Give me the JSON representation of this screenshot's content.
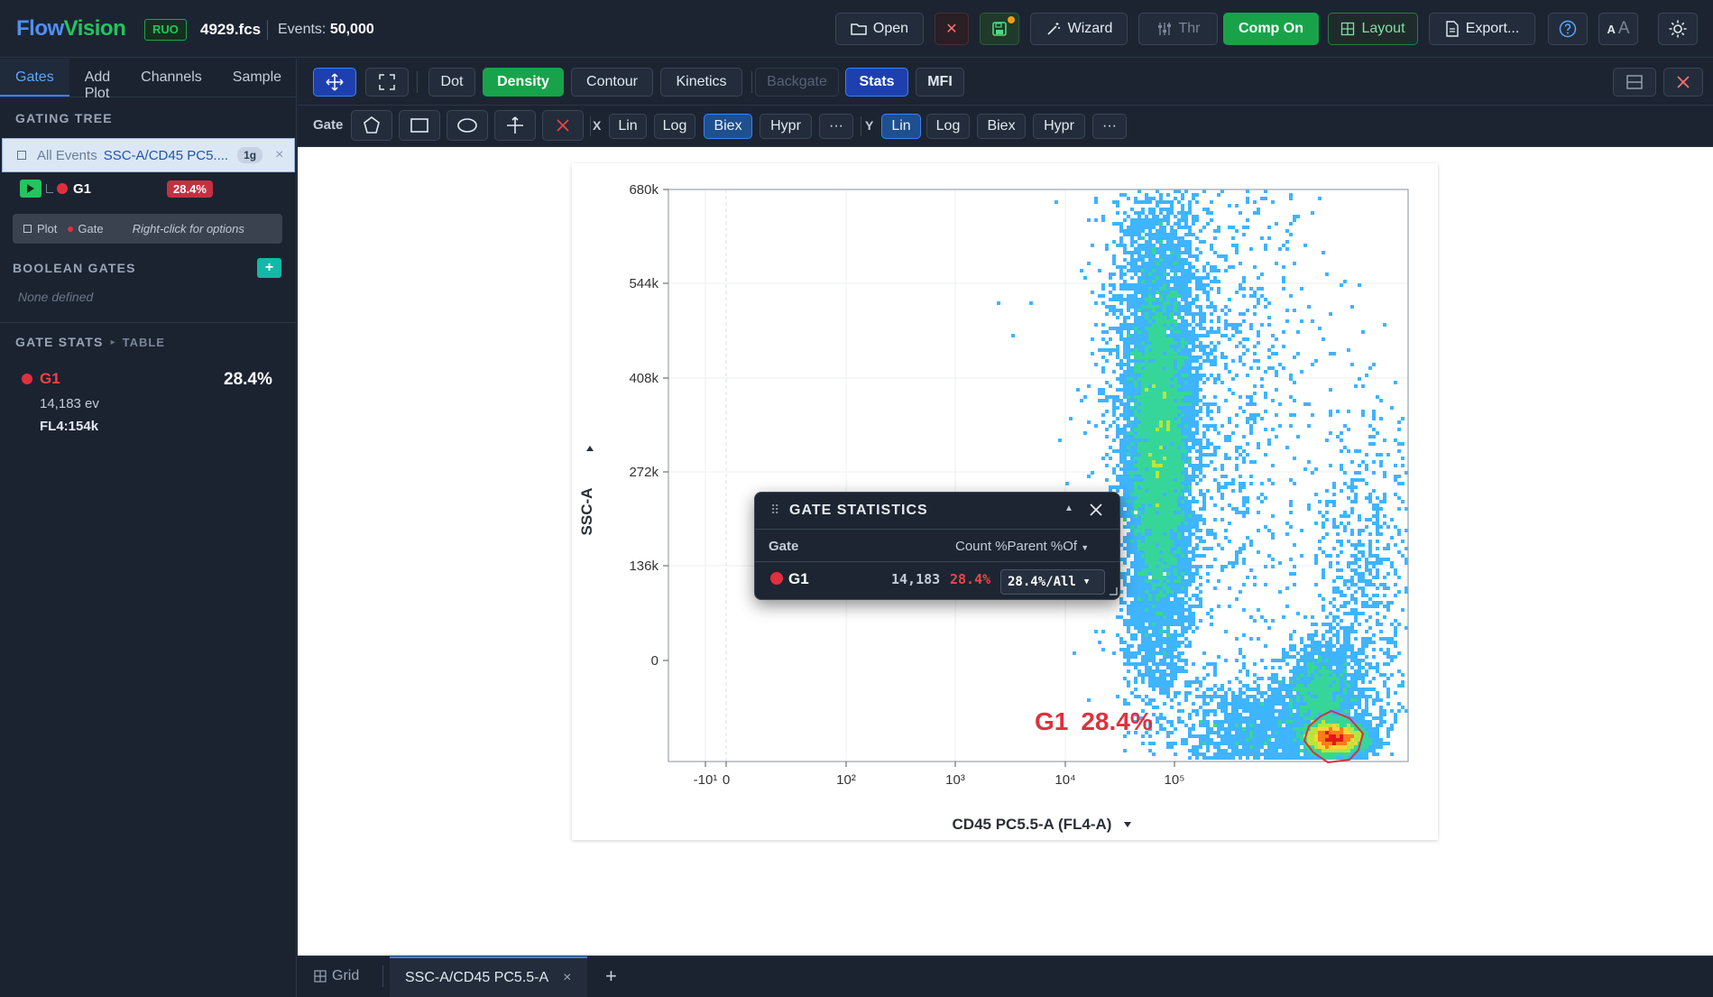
{
  "app": {
    "brand_part1": "Flow",
    "brand_part2": "Vision",
    "badge": "RUO",
    "file_name": "4929.fcs",
    "events_label": "Events:",
    "events_count": "50,000"
  },
  "topbar": {
    "open": "Open",
    "close": "✕",
    "wizard": "Wizard",
    "thr": "Thr",
    "comp": "Comp On",
    "layout": "Layout",
    "export": "Export...",
    "font_small": "A",
    "font_large": "A"
  },
  "sidebar": {
    "tabs": [
      "Gates",
      "Add Plot",
      "Channels",
      "Sample"
    ],
    "gating_tree_title": "GATING TREE",
    "root_label": "All Events",
    "root_plot": "SSC-A/CD45 PC5....",
    "root_badge": "1g",
    "root_close": "×",
    "child_gate": "G1",
    "child_pct": "28.4%",
    "hint_plot": "Plot",
    "hint_gate": "Gate",
    "hint_text": "Right-click for options",
    "boolean_title": "BOOLEAN GATES",
    "boolean_add": "+",
    "boolean_empty": "None defined",
    "stats_title": "GATE STATS",
    "stats_arrow": "▸",
    "stats_table": "TABLE",
    "stats_gate": "G1",
    "stats_pct": "28.4%",
    "stats_events": "14,183 ev",
    "stats_mfi": "FL4:154k"
  },
  "toolbar1": {
    "dot": "Dot",
    "density": "Density",
    "contour": "Contour",
    "kinetics": "Kinetics",
    "backgate": "Backgate",
    "stats": "Stats",
    "mfi": "MFI"
  },
  "toolbar2": {
    "gate_label": "Gate",
    "x_label": "X",
    "y_label": "Y",
    "x_scales": [
      "Lin",
      "Log",
      "Biex",
      "Hypr",
      "···"
    ],
    "y_scales": [
      "Lin",
      "Log",
      "Biex",
      "Hypr",
      "···"
    ],
    "x_selected": "Biex",
    "y_selected": "Lin"
  },
  "plot": {
    "ylabel": "SSC-A",
    "xlabel": "CD45 PC5.5-A (FL4-A)",
    "y_ticks": [
      "680k",
      "544k",
      "408k",
      "272k",
      "136k",
      "0"
    ],
    "x_ticks": [
      "-10¹",
      "0",
      "10²",
      "10³",
      "10⁴",
      "10⁵"
    ],
    "gate_name": "G1",
    "gate_pct": "28.4%"
  },
  "popup": {
    "title": "GATE STATISTICS",
    "col_gate": "Gate",
    "col_stats": "Count %Parent %Of",
    "row_gate": "G1",
    "row_count": "14,183",
    "row_pct": "28.4%",
    "row_of": "28.4%/All"
  },
  "bottom": {
    "grid": "Grid",
    "tab": "SSC-A/CD45 PC5.5-A",
    "tab_close": "×",
    "add": "+"
  },
  "colors": {
    "accent_blue": "#3b82f6",
    "accent_green": "#18a34a",
    "gate_red": "#e0303f"
  }
}
